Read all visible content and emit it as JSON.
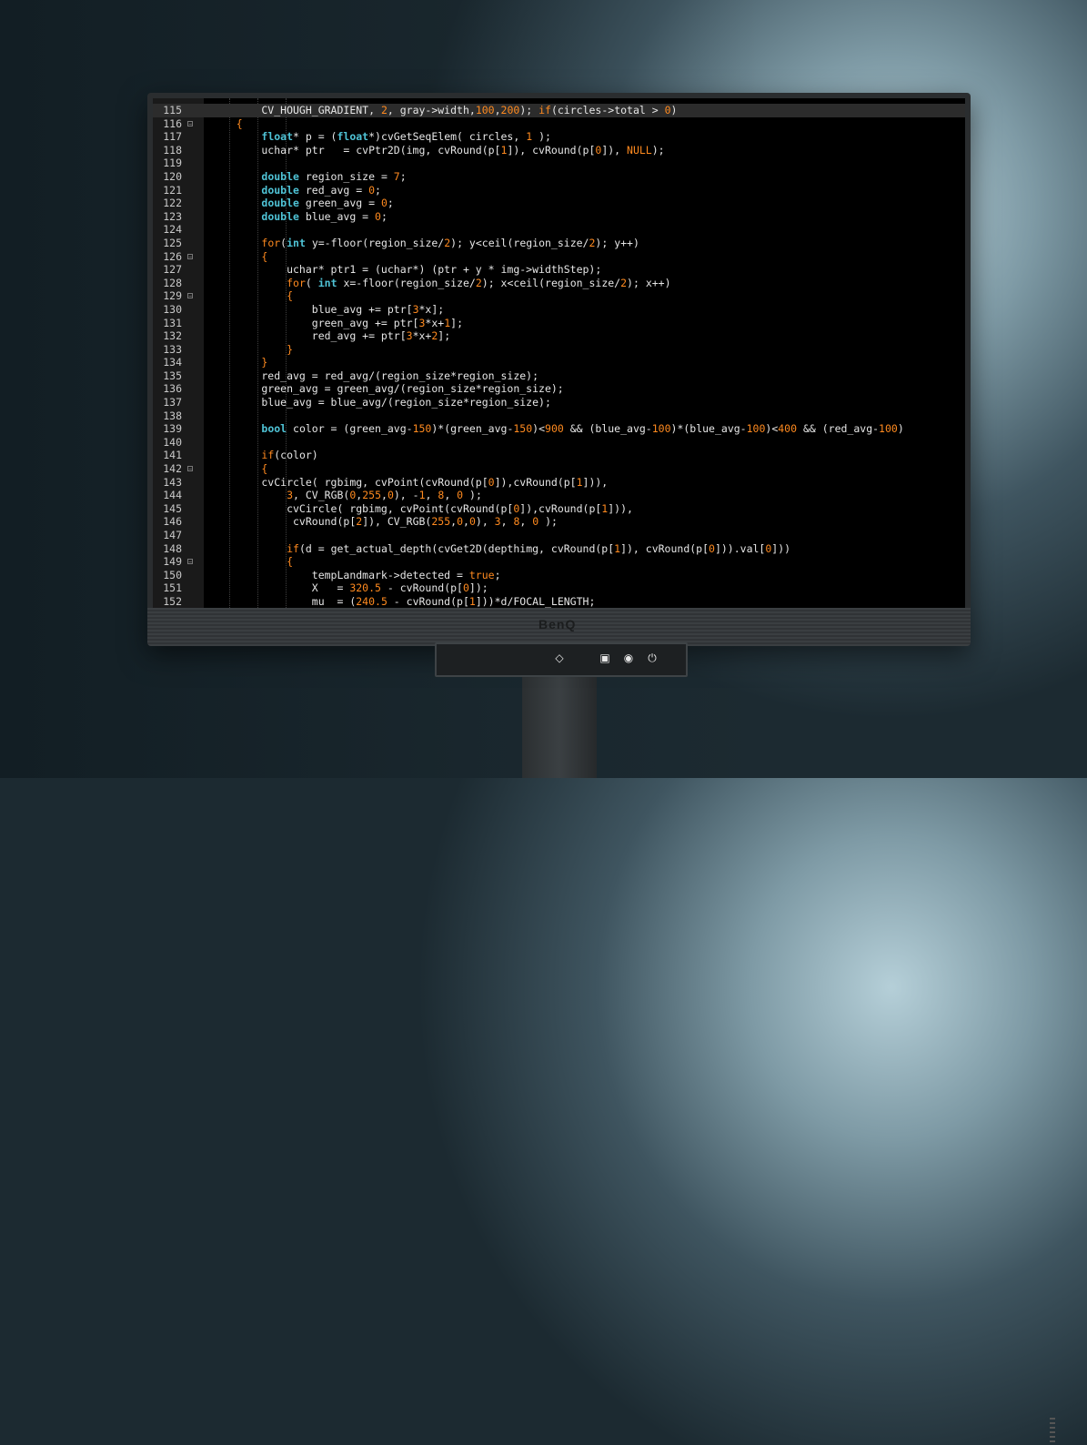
{
  "monitor": {
    "brand": "BenQ"
  },
  "editor": {
    "lines": [
      {
        "n": "115",
        "fold": false,
        "current": true,
        "tokens": [
          [
            "p",
            "        CV_HOUGH_GRADIENT, "
          ],
          [
            "num",
            "2"
          ],
          [
            "p",
            ", gray->width,"
          ],
          [
            "num",
            "100"
          ],
          [
            "p",
            ","
          ],
          [
            "num",
            "200"
          ],
          [
            "p",
            "); "
          ],
          [
            "ctl",
            "if"
          ],
          [
            "p",
            "(circles->total > "
          ],
          [
            "num",
            "0"
          ],
          [
            "p",
            ")"
          ]
        ]
      },
      {
        "n": "116",
        "fold": true,
        "tokens": [
          [
            "op",
            "    {"
          ]
        ]
      },
      {
        "n": "117",
        "fold": false,
        "tokens": [
          [
            "p",
            "        "
          ],
          [
            "kw",
            "float"
          ],
          [
            "p",
            "* p = ("
          ],
          [
            "kw",
            "float"
          ],
          [
            "p",
            "*)cvGetSeqElem( circles, "
          ],
          [
            "num",
            "1"
          ],
          [
            "p",
            " );"
          ]
        ]
      },
      {
        "n": "118",
        "fold": false,
        "tokens": [
          [
            "p",
            "        uchar* ptr   = cvPtr2D(img, cvRound(p["
          ],
          [
            "num",
            "1"
          ],
          [
            "p",
            "]), cvRound(p["
          ],
          [
            "num",
            "0"
          ],
          [
            "p",
            "]), "
          ],
          [
            "ctl",
            "NULL"
          ],
          [
            "p",
            ");"
          ]
        ]
      },
      {
        "n": "119",
        "fold": false,
        "tokens": []
      },
      {
        "n": "120",
        "fold": false,
        "tokens": [
          [
            "p",
            "        "
          ],
          [
            "kw",
            "double"
          ],
          [
            "p",
            " region_size = "
          ],
          [
            "num",
            "7"
          ],
          [
            "p",
            ";"
          ]
        ]
      },
      {
        "n": "121",
        "fold": false,
        "tokens": [
          [
            "p",
            "        "
          ],
          [
            "kw",
            "double"
          ],
          [
            "p",
            " red_avg = "
          ],
          [
            "num",
            "0"
          ],
          [
            "p",
            ";"
          ]
        ]
      },
      {
        "n": "122",
        "fold": false,
        "tokens": [
          [
            "p",
            "        "
          ],
          [
            "kw",
            "double"
          ],
          [
            "p",
            " green_avg = "
          ],
          [
            "num",
            "0"
          ],
          [
            "p",
            ";"
          ]
        ]
      },
      {
        "n": "123",
        "fold": false,
        "tokens": [
          [
            "p",
            "        "
          ],
          [
            "kw",
            "double"
          ],
          [
            "p",
            " blue_avg = "
          ],
          [
            "num",
            "0"
          ],
          [
            "p",
            ";"
          ]
        ]
      },
      {
        "n": "124",
        "fold": false,
        "tokens": []
      },
      {
        "n": "125",
        "fold": false,
        "tokens": [
          [
            "p",
            "        "
          ],
          [
            "ctl",
            "for"
          ],
          [
            "p",
            "("
          ],
          [
            "kw",
            "int"
          ],
          [
            "p",
            " y=-floor(region_size/"
          ],
          [
            "num",
            "2"
          ],
          [
            "p",
            "); y<ceil(region_size/"
          ],
          [
            "num",
            "2"
          ],
          [
            "p",
            "); y++)"
          ]
        ]
      },
      {
        "n": "126",
        "fold": true,
        "tokens": [
          [
            "op",
            "        {"
          ]
        ]
      },
      {
        "n": "127",
        "fold": false,
        "tokens": [
          [
            "p",
            "            uchar* ptr1 = (uchar*) (ptr + y * img->widthStep);"
          ]
        ]
      },
      {
        "n": "128",
        "fold": false,
        "tokens": [
          [
            "p",
            "            "
          ],
          [
            "ctl",
            "for"
          ],
          [
            "p",
            "( "
          ],
          [
            "kw",
            "int"
          ],
          [
            "p",
            " x=-floor(region_size/"
          ],
          [
            "num",
            "2"
          ],
          [
            "p",
            "); x<ceil(region_size/"
          ],
          [
            "num",
            "2"
          ],
          [
            "p",
            "); x++)"
          ]
        ]
      },
      {
        "n": "129",
        "fold": true,
        "tokens": [
          [
            "op",
            "            {"
          ]
        ]
      },
      {
        "n": "130",
        "fold": false,
        "tokens": [
          [
            "p",
            "                blue_avg += ptr["
          ],
          [
            "num",
            "3"
          ],
          [
            "p",
            "*x];"
          ]
        ]
      },
      {
        "n": "131",
        "fold": false,
        "tokens": [
          [
            "p",
            "                green_avg += ptr["
          ],
          [
            "num",
            "3"
          ],
          [
            "p",
            "*x+"
          ],
          [
            "num",
            "1"
          ],
          [
            "p",
            "];"
          ]
        ]
      },
      {
        "n": "132",
        "fold": false,
        "tokens": [
          [
            "p",
            "                red_avg += ptr["
          ],
          [
            "num",
            "3"
          ],
          [
            "p",
            "*x+"
          ],
          [
            "num",
            "2"
          ],
          [
            "p",
            "];"
          ]
        ]
      },
      {
        "n": "133",
        "fold": false,
        "tokens": [
          [
            "op",
            "            }"
          ]
        ]
      },
      {
        "n": "134",
        "fold": false,
        "tokens": [
          [
            "op",
            "        }"
          ]
        ]
      },
      {
        "n": "135",
        "fold": false,
        "tokens": [
          [
            "p",
            "        red_avg = red_avg/(region_size*region_size);"
          ]
        ]
      },
      {
        "n": "136",
        "fold": false,
        "tokens": [
          [
            "p",
            "        green_avg = green_avg/(region_size*region_size);"
          ]
        ]
      },
      {
        "n": "137",
        "fold": false,
        "tokens": [
          [
            "p",
            "        blue_avg = blue_avg/(region_size*region_size);"
          ]
        ]
      },
      {
        "n": "138",
        "fold": false,
        "tokens": []
      },
      {
        "n": "139",
        "fold": false,
        "tokens": [
          [
            "p",
            "        "
          ],
          [
            "kw",
            "bool"
          ],
          [
            "p",
            " color = (green_avg-"
          ],
          [
            "num",
            "150"
          ],
          [
            "p",
            ")*(green_avg-"
          ],
          [
            "num",
            "150"
          ],
          [
            "p",
            ")<"
          ],
          [
            "num",
            "900"
          ],
          [
            "p",
            " && (blue_avg-"
          ],
          [
            "num",
            "100"
          ],
          [
            "p",
            ")*(blue_avg-"
          ],
          [
            "num",
            "100"
          ],
          [
            "p",
            ")<"
          ],
          [
            "num",
            "400"
          ],
          [
            "p",
            " && (red_avg-"
          ],
          [
            "num",
            "100"
          ],
          [
            "p",
            ")"
          ]
        ]
      },
      {
        "n": "140",
        "fold": false,
        "tokens": []
      },
      {
        "n": "141",
        "fold": false,
        "tokens": [
          [
            "p",
            "        "
          ],
          [
            "ctl",
            "if"
          ],
          [
            "p",
            "(color)"
          ]
        ]
      },
      {
        "n": "142",
        "fold": true,
        "tokens": [
          [
            "op",
            "        {"
          ]
        ]
      },
      {
        "n": "143",
        "fold": false,
        "tokens": [
          [
            "p",
            "        cvCircle( rgbimg, cvPoint(cvRound(p["
          ],
          [
            "num",
            "0"
          ],
          [
            "p",
            "]),cvRound(p["
          ],
          [
            "num",
            "1"
          ],
          [
            "p",
            "])),"
          ]
        ]
      },
      {
        "n": "144",
        "fold": false,
        "tokens": [
          [
            "p",
            "            "
          ],
          [
            "num",
            "3"
          ],
          [
            "p",
            ", CV_RGB("
          ],
          [
            "num",
            "0"
          ],
          [
            "p",
            ","
          ],
          [
            "num",
            "255"
          ],
          [
            "p",
            ","
          ],
          [
            "num",
            "0"
          ],
          [
            "p",
            "), -"
          ],
          [
            "num",
            "1"
          ],
          [
            "p",
            ", "
          ],
          [
            "num",
            "8"
          ],
          [
            "p",
            ", "
          ],
          [
            "num",
            "0"
          ],
          [
            "p",
            " );"
          ]
        ]
      },
      {
        "n": "145",
        "fold": false,
        "tokens": [
          [
            "p",
            "            cvCircle( rgbimg, cvPoint(cvRound(p["
          ],
          [
            "num",
            "0"
          ],
          [
            "p",
            "]),cvRound(p["
          ],
          [
            "num",
            "1"
          ],
          [
            "p",
            "])),"
          ]
        ]
      },
      {
        "n": "146",
        "fold": false,
        "tokens": [
          [
            "p",
            "             cvRound(p["
          ],
          [
            "num",
            "2"
          ],
          [
            "p",
            "]), CV_RGB("
          ],
          [
            "num",
            "255"
          ],
          [
            "p",
            ","
          ],
          [
            "num",
            "0"
          ],
          [
            "p",
            ","
          ],
          [
            "num",
            "0"
          ],
          [
            "p",
            "), "
          ],
          [
            "num",
            "3"
          ],
          [
            "p",
            ", "
          ],
          [
            "num",
            "8"
          ],
          [
            "p",
            ", "
          ],
          [
            "num",
            "0"
          ],
          [
            "p",
            " );"
          ]
        ]
      },
      {
        "n": "147",
        "fold": false,
        "tokens": []
      },
      {
        "n": "148",
        "fold": false,
        "tokens": [
          [
            "p",
            "            "
          ],
          [
            "ctl",
            "if"
          ],
          [
            "p",
            "(d = get_actual_depth(cvGet2D(depthimg, cvRound(p["
          ],
          [
            "num",
            "1"
          ],
          [
            "p",
            "]), cvRound(p["
          ],
          [
            "num",
            "0"
          ],
          [
            "p",
            "])).val["
          ],
          [
            "num",
            "0"
          ],
          [
            "p",
            "]))"
          ]
        ]
      },
      {
        "n": "149",
        "fold": true,
        "tokens": [
          [
            "op",
            "            {"
          ]
        ]
      },
      {
        "n": "150",
        "fold": false,
        "tokens": [
          [
            "p",
            "                tempLandmark->detected = "
          ],
          [
            "ctl",
            "true"
          ],
          [
            "p",
            ";"
          ]
        ]
      },
      {
        "n": "151",
        "fold": false,
        "tokens": [
          [
            "p",
            "                X   = "
          ],
          [
            "num",
            "320.5"
          ],
          [
            "p",
            " - cvRound(p["
          ],
          [
            "num",
            "0"
          ],
          [
            "p",
            "]);"
          ]
        ]
      },
      {
        "n": "152",
        "fold": false,
        "tokens": [
          [
            "p",
            "                mu  = ("
          ],
          [
            "num",
            "240.5"
          ],
          [
            "p",
            " - cvRound(p["
          ],
          [
            "num",
            "1"
          ],
          [
            "p",
            "]))*d/FOCAL_LENGTH;"
          ]
        ]
      }
    ]
  },
  "controls": [
    {
      "name": "input-switch-icon",
      "glyph": "◇"
    },
    {
      "name": "display-mode-icon",
      "glyph": "▣"
    },
    {
      "name": "eye-care-icon",
      "glyph": "◉"
    },
    {
      "name": "power-icon",
      "glyph": "⏻"
    }
  ]
}
